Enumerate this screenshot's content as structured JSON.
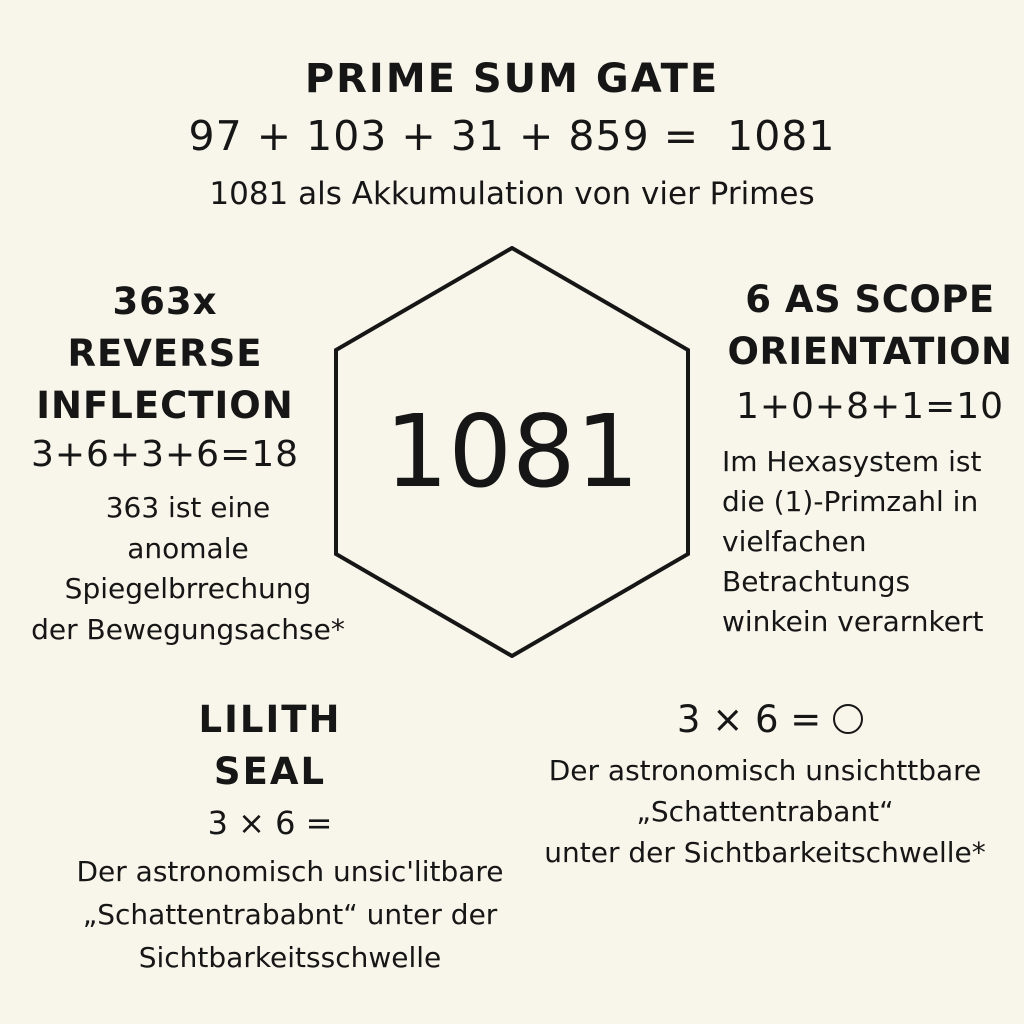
{
  "header": {
    "title": "PRIME SUM GATE",
    "equation": "97 + 103 + 31 + 859 =  1081",
    "subtitle": "1081 als Akkumulation von vier Primes"
  },
  "center": {
    "number": "1081",
    "shape_icon": "hexagon-outline"
  },
  "left_block": {
    "heading": [
      "363x",
      "REVERSE",
      "INFLECTION"
    ],
    "formula": "3+6+3+6=18",
    "text": [
      "363 ist eine",
      "anomale",
      "Spiegelbrrechung",
      "der Bewegungsachse*"
    ]
  },
  "right_block": {
    "heading": [
      "6 AS SCOPE",
      "ORIENTATION"
    ],
    "formula": "1+0+8+1=10",
    "text": [
      "Im Hexasystem ist",
      "die (1)-Primzahl in",
      "vielfachen",
      "Betrachtungs",
      "winkein verarnkert"
    ]
  },
  "bottom_left_block": {
    "heading": [
      "LILITH",
      "SEAL"
    ],
    "formula": "3 × 6 =",
    "text": [
      "Der astronomisch unsic'litbare",
      "„Schattentrababnt“ unter der",
      "Sichtbarkeitsschwelle"
    ]
  },
  "bottom_right_block": {
    "formula": "3 × 6 =",
    "circle_icon": "circle-outline",
    "text": [
      "Der astronomisch unsichttbare",
      "„Schattentrabant“",
      "unter der Sichtbarkeitschwelle*"
    ]
  }
}
